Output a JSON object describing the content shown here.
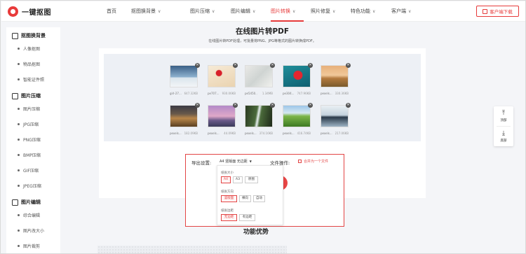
{
  "header": {
    "logo_text": "一键抠图",
    "nav": [
      {
        "label": "首页",
        "dropdown": false,
        "active": false
      },
      {
        "label": "抠图换背景",
        "dropdown": true,
        "active": false
      },
      {
        "label": "图片压缩",
        "dropdown": true,
        "active": false
      },
      {
        "label": "图片编辑",
        "dropdown": true,
        "active": false
      },
      {
        "label": "图片转换",
        "dropdown": true,
        "active": true
      },
      {
        "label": "照片修复",
        "dropdown": true,
        "active": false
      },
      {
        "label": "特色功能",
        "dropdown": true,
        "active": false
      },
      {
        "label": "客户端",
        "dropdown": true,
        "active": false
      }
    ],
    "download_label": "客户端下载"
  },
  "sidebar": {
    "groups": [
      {
        "title": "抠图换背景",
        "icon": "cutout-icon",
        "items": [
          "人像抠图",
          "物品抠图",
          "智能证件照"
        ]
      },
      {
        "title": "图片压缩",
        "icon": "compress-icon",
        "items": [
          "图片压缩",
          "JPG压缩",
          "PNG压缩",
          "BMP压缩",
          "GIF压缩",
          "JPEG压缩"
        ]
      },
      {
        "title": "图片编辑",
        "icon": "edit-icon",
        "items": [
          "综合编辑",
          "图片改大小",
          "图片裁剪"
        ]
      }
    ]
  },
  "main": {
    "title": "在线图片转PDF",
    "subtitle": "在线图片转PDF处理，可批量将PNG、JPG等格式的图片转换成PDF。",
    "thumbnails": [
      {
        "name": "girl-27...",
        "size": "647.32KB"
      },
      {
        "name": "pe707...",
        "size": "930.06KB"
      },
      {
        "name": "pe5450...",
        "size": "1.34MB"
      },
      {
        "name": "pe304...",
        "size": "747.96KB"
      },
      {
        "name": "pexels...",
        "size": "330.36KB"
      },
      {
        "name": "pexels...",
        "size": "182.09KB"
      },
      {
        "name": "pexels...",
        "size": "44.09KB"
      },
      {
        "name": "pexels...",
        "size": "374.16KB"
      },
      {
        "name": "pexels...",
        "size": "416.74KB"
      },
      {
        "name": "pexels...",
        "size": "217.06KB"
      }
    ],
    "export": {
      "label": "导出设置:",
      "selected": "A4 竖版面 无边距",
      "file_op_label": "文件操作:",
      "merge_label": "合并为一个文件",
      "dropdown": {
        "size_label": "纸张大小",
        "sizes": [
          "A4",
          "A3",
          "原图"
        ],
        "orientation_label": "纸张方向",
        "orientations": [
          "竖版面",
          "横向",
          "自动"
        ],
        "margin_label": "纸张边距",
        "margins": [
          "无边距",
          "有边距"
        ]
      }
    },
    "feature_title": "功能优势"
  },
  "float_bar": {
    "top_label": "顶部",
    "bottom_label": "底部"
  },
  "colors": {
    "accent": "#e63a3a"
  }
}
